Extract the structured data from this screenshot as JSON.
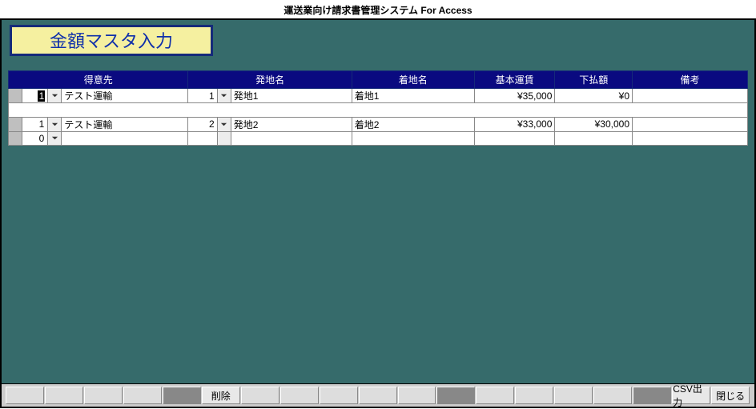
{
  "app_title": "運送業向け請求書管理システム For Access",
  "page_title": "金額マスタ入力",
  "columns": {
    "tokuisaki": "得意先",
    "hatchi": "発地名",
    "chakuchi": "着地名",
    "kihon": "基本運賃",
    "shita": "下払額",
    "biko": "備考"
  },
  "rows": [
    {
      "num1": "1",
      "tokuisaki": "テスト運輸",
      "num2": "1",
      "hatchi": "発地1",
      "chakuchi": "着地1",
      "kihon": "¥35,000",
      "shita": "¥0",
      "biko": "",
      "focused": true
    },
    {
      "num1": "1",
      "tokuisaki": "テスト運輸",
      "num2": "2",
      "hatchi": "発地2",
      "chakuchi": "着地2",
      "kihon": "¥33,000",
      "shita": "¥30,000",
      "biko": "",
      "focused": false
    },
    {
      "num1": "0",
      "tokuisaki": "",
      "num2": "",
      "hatchi": "",
      "chakuchi": "",
      "kihon": "",
      "shita": "",
      "biko": "",
      "focused": false,
      "is_new": true
    }
  ],
  "footer": {
    "delete": "削除",
    "csv": "CSV出力",
    "close": "閉じる"
  }
}
